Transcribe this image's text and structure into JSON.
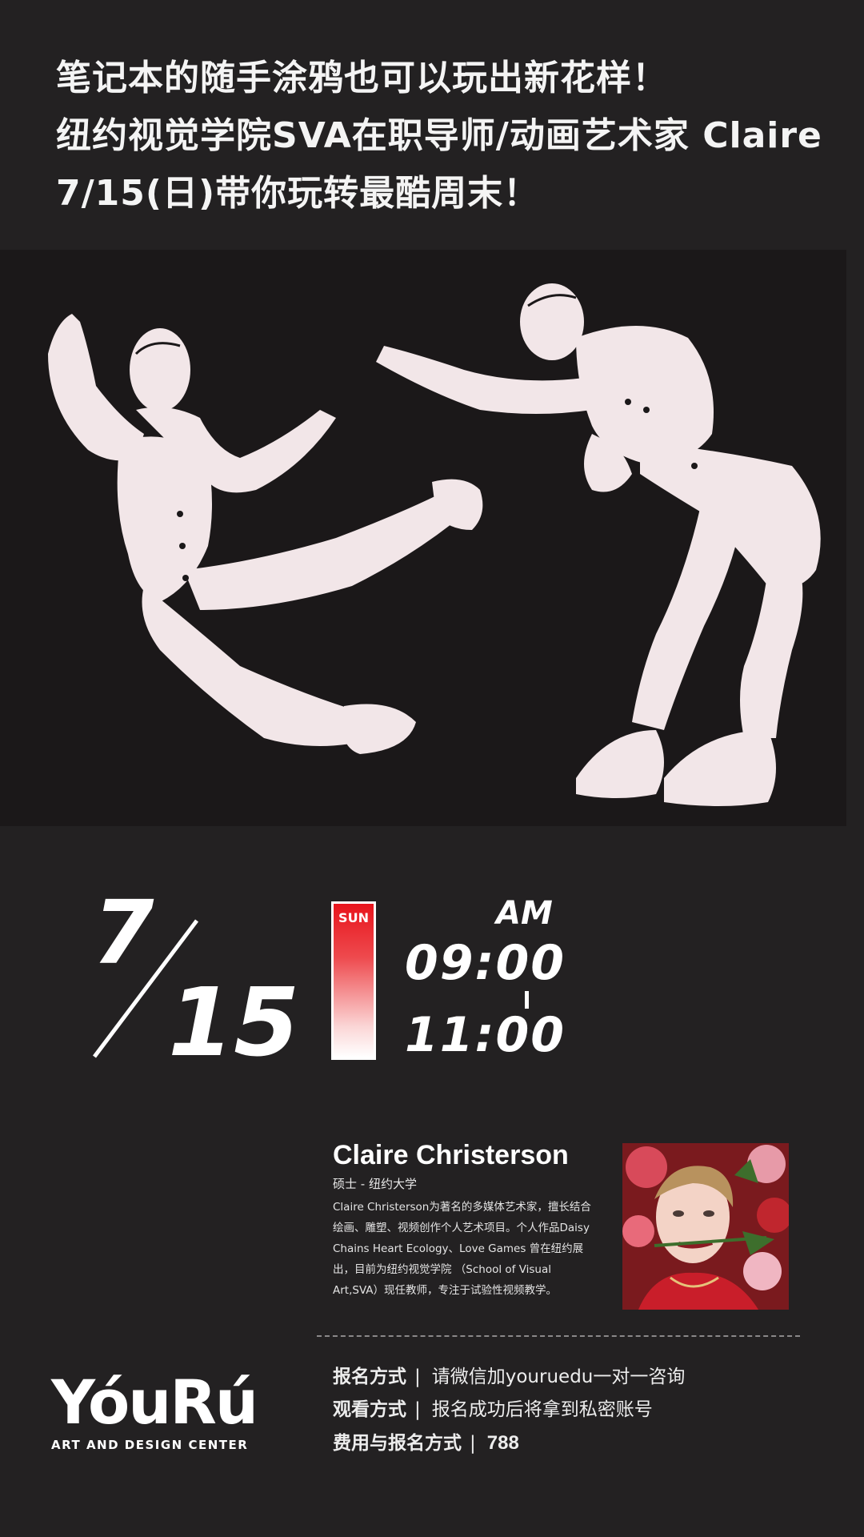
{
  "headline": {
    "line1": "笔记本的随手涂鸦也可以玩出新花样！",
    "line2": "纽约视觉学院SVA在职导师/动画艺术家 Claire",
    "line3": "7/15(日)带你玩转最酷周末！"
  },
  "event": {
    "month": "7",
    "day": "15",
    "weekday": "SUN",
    "ampm": "AM",
    "start_time": "09:00",
    "end_time": "11:00"
  },
  "instructor": {
    "name": "Claire Christerson",
    "degree": "硕士 - 纽约大学",
    "bio": "Claire  Christerson为著名的多媒体艺术家，擅长结合绘画、雕塑、视频创作个人艺术项目。个人作品Daisy Chains Heart Ecology、Love Games 曾在纽约展出，目前为纽约视觉学院 （School of Visual Art,SVA）现任教师，专注于试验性视频教学。"
  },
  "logo": {
    "mark": "YóuRú",
    "subtitle": "ART AND DESIGN CENTER"
  },
  "info": {
    "rows": [
      {
        "label": "报名方式",
        "value": "请微信加youruedu一对一咨询"
      },
      {
        "label": "观看方式",
        "value": "报名成功后将拿到私密账号"
      },
      {
        "label": "费用与报名方式",
        "value": "788"
      }
    ],
    "separator": "|"
  },
  "colors": {
    "background": "#232122",
    "accent_red": "#e8141c",
    "figure": "#f2e6e8"
  }
}
